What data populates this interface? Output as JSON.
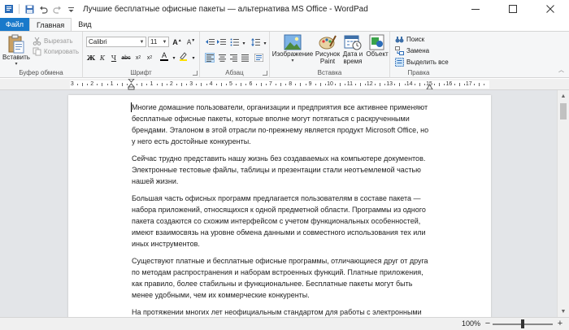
{
  "window": {
    "title": "Лучшие бесплатные офисные пакеты — альтернатива MS Office - WordPad"
  },
  "tabs": {
    "file": "Файл",
    "home": "Главная",
    "view": "Вид"
  },
  "ribbon": {
    "clipboard": {
      "group_label": "Буфер обмена",
      "paste": "Вставить",
      "cut": "Вырезать",
      "copy": "Копировать"
    },
    "font": {
      "group_label": "Шрифт",
      "family": "Calibri",
      "size": "11"
    },
    "paragraph": {
      "group_label": "Абзац"
    },
    "insert": {
      "group_label": "Вставка",
      "image": "Изображение",
      "paint_line1": "Рисунок",
      "paint_line2": "Paint",
      "datetime_line1": "Дата и",
      "datetime_line2": "время",
      "object": "Объект"
    },
    "editing": {
      "group_label": "Правка",
      "find": "Поиск",
      "replace": "Замена",
      "select_all": "Выделить все"
    }
  },
  "ruler": {
    "labels": [
      "3",
      "2",
      "1",
      "1",
      "2",
      "3",
      "4",
      "5",
      "6",
      "7",
      "8",
      "9",
      "10",
      "11",
      "12",
      "13",
      "14",
      "15",
      "16",
      "17"
    ]
  },
  "document": {
    "paragraphs": [
      "Многие домашние пользователи, организации и  предприятия все активнее применяют бесплатные офисные пакеты, которые вполне могут потягаться с раскрученными брендами. Эталоном в этой отрасли по-прежнему является продукт Microsoft Office, но у него есть достойные конкуренты.",
      "Сейчас трудно представить нашу жизнь без создаваемых на компьютере документов. Электронные тестовые файлы, таблицы и презентации стали неотъемлемой частью нашей жизни.",
      "Большая часть офисных программ предлагается пользователям в составе пакета — набора приложений, относящихся к одной предметной области. Программы из одного пакета создаются со схожим интерфейсом с учетом функциональных особенностей, имеют взаимосвязь на уровне обмена данными и совместного использования тех или иных инструментов.",
      "Существуют платные и бесплатные офисные программы, отличающиеся друг от друга по методам распространения и наборам встроенных функций. Платные приложения, как правило, более стабильны и функциональнее. Бесплатные пакеты могут быть менее удобными, чем их коммерческие конкуренты.",
      "На протяжении многих лет неофициальным стандартом для работы с электронными документами является разработка компании Microsoft — приложения Office. Это самый продвинутый и популярный пакет программ для Windows, стабильный."
    ]
  },
  "status": {
    "zoom": "100%",
    "zoom_fraction": 0.5
  },
  "colors": {
    "accent": "#1979ca",
    "ribbon_bg": "#f5f6f7",
    "doc_bg": "#e3e5e8"
  }
}
